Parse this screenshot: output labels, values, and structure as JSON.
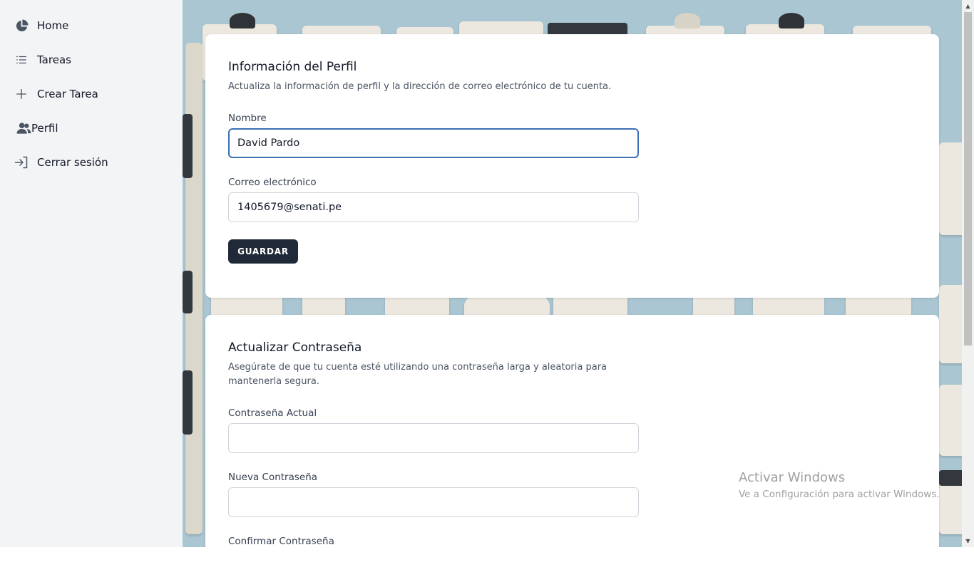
{
  "sidebar": {
    "items": [
      {
        "label": "Home",
        "icon": "pie-chart-icon"
      },
      {
        "label": "Tareas",
        "icon": "list-icon"
      },
      {
        "label": "Crear Tarea",
        "icon": "plus-icon"
      },
      {
        "label": "Perfil",
        "icon": "users-icon"
      },
      {
        "label": "Cerrar sesión",
        "icon": "logout-icon"
      }
    ]
  },
  "profile": {
    "title": "Información del Perfil",
    "description": "Actualiza la información de perfil y la dirección de correo electrónico de tu cuenta.",
    "name_label": "Nombre",
    "name_value": "David Pardo",
    "email_label": "Correo electrónico",
    "email_value": "1405679@senati.pe",
    "save_label": "GUARDAR"
  },
  "password": {
    "title": "Actualizar Contraseña",
    "description": "Asegúrate de que tu cuenta esté utilizando una contraseña larga y aleatoria para mantenerla segura.",
    "current_label": "Contraseña Actual",
    "new_label": "Nueva Contraseña",
    "confirm_label": "Confirmar Contraseña"
  },
  "watermark": {
    "title": "Activar Windows",
    "subtitle": "Ve a Configuración para activar Windows."
  },
  "colors": {
    "sidebar_bg": "#f3f4f6",
    "button_bg": "#1f2937",
    "focus_border": "#3b6fb6",
    "background_accent": "#a9c6d2"
  }
}
